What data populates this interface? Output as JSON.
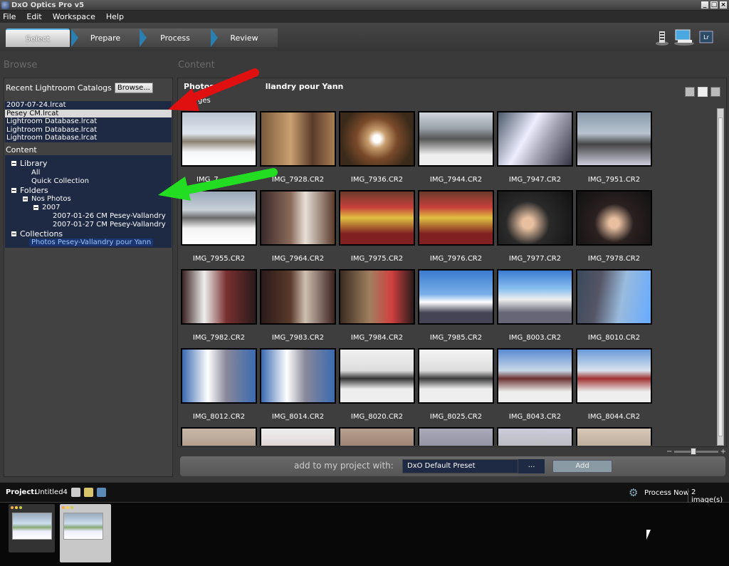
{
  "window": {
    "title": "DxO Optics Pro v5",
    "controls": [
      "_",
      "□",
      "×"
    ]
  },
  "menu": [
    "File",
    "Edit",
    "Workspace",
    "Help"
  ],
  "workflow_steps": [
    "Select",
    "Prepare",
    "Process",
    "Review"
  ],
  "active_step": "Select",
  "headers": {
    "browse": "Browse",
    "content": "Content"
  },
  "left_panel": {
    "recent_label": "Recent Lightroom Catalogs",
    "browse_button": "Browse...",
    "catalogs": [
      "2007-07-24.lrcat",
      "Pesey CM.lrcat",
      "Lightroom Database.lrcat",
      "Lightroom Database.lrcat",
      "Lightroom Database.lrcat"
    ],
    "selected_catalog_index": 1,
    "content_label": "Content",
    "tree": {
      "library": "Library",
      "all": "All",
      "quick_collection": "Quick Collection",
      "folders": "Folders",
      "nos_photos": "Nos Photos",
      "year": "2007",
      "folder1": "2007-01-26 CM Pesey-Vallandry",
      "folder2": "2007-01-27 CM Pesey-Vallandry",
      "collections": "Collections",
      "collection1": "Photos Pesey-Vallandry pour Yann"
    }
  },
  "content": {
    "title": "Photos Pesey-Vallandry pour Yann",
    "title_visible": "Photos P",
    "title_tail": "llandry pour Yann",
    "count_visible": "ges",
    "captions_row1": [
      "IMG_7928.CR2",
      "IMG_7936.CR2",
      "IMG_7944.CR2",
      "IMG_7947.CR2",
      "IMG_7951.CR2"
    ],
    "caption_first_row1_partial": "IMG_7",
    "captions_row2": [
      "IMG_7955.CR2",
      "IMG_7964.CR2",
      "IMG_7975.CR2",
      "IMG_7976.CR2",
      "IMG_7977.CR2",
      "IMG_7978.CR2"
    ],
    "captions_row3": [
      "IMG_7982.CR2",
      "IMG_7983.CR2",
      "IMG_7984.CR2",
      "IMG_7985.CR2",
      "IMG_8003.CR2",
      "IMG_8010.CR2"
    ],
    "captions_row4": [
      "IMG_8012.CR2",
      "IMG_8014.CR2",
      "IMG_8020.CR2",
      "IMG_8025.CR2",
      "IMG_8043.CR2",
      "IMG_8044.CR2"
    ]
  },
  "zoom": {
    "minus": "−",
    "plus": "+",
    "level": 0.35
  },
  "add_bar": {
    "label": "add to my project with:",
    "preset": "DxO Default Preset",
    "dots": "...",
    "add_button": "Add"
  },
  "project": {
    "label": "Project:",
    "name": "Untitled4",
    "process_now": "Process Now",
    "image_count": "2 image(s)"
  },
  "colors": {
    "accent": "#2a7fb0",
    "selection": "#1a3570",
    "panel_bg": "#1e2a44",
    "red_arrow": "#e01010",
    "green_arrow": "#22dd22"
  }
}
